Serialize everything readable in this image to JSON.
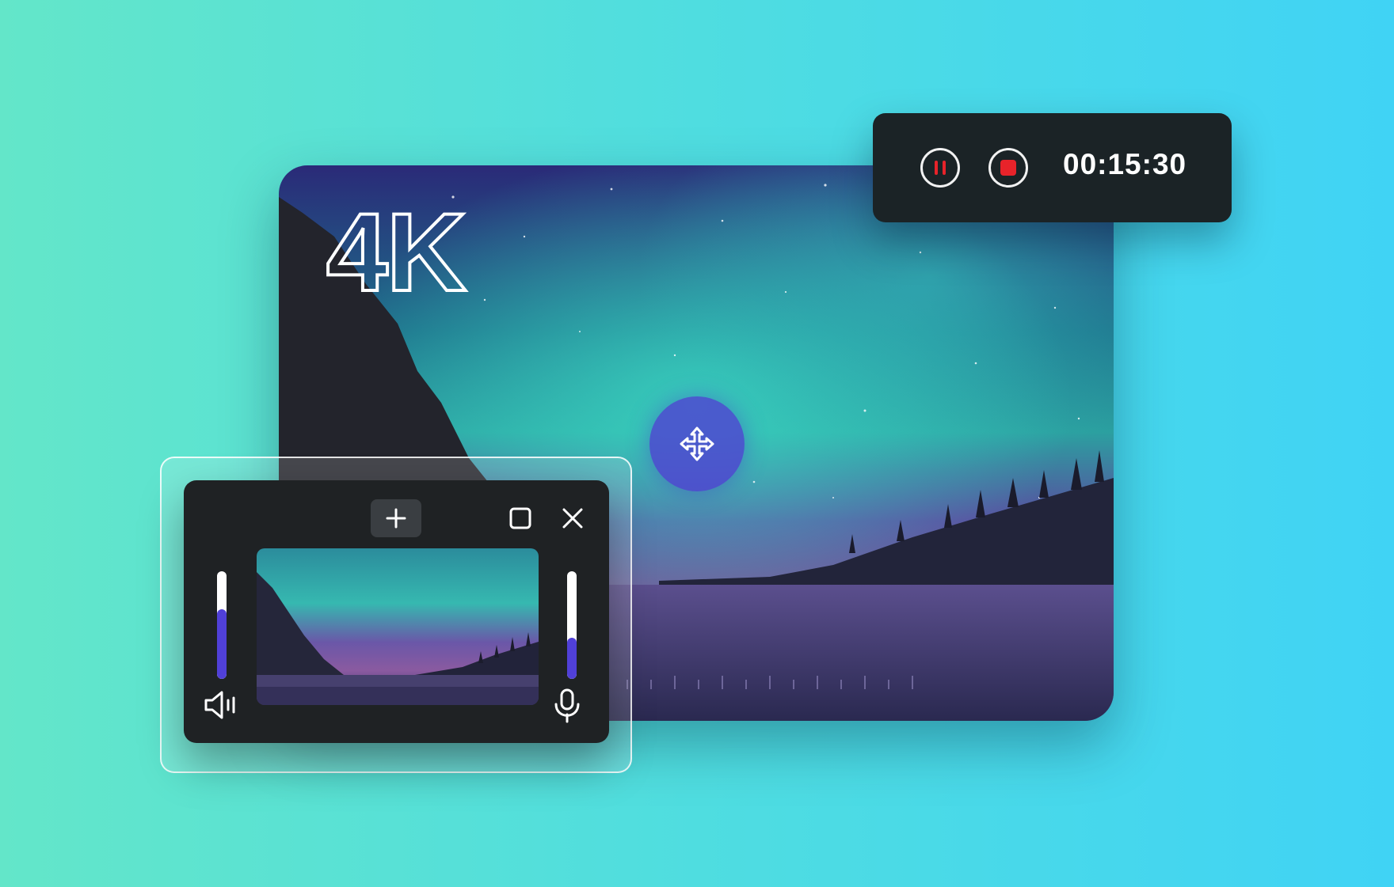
{
  "main_video": {
    "badge": "4K"
  },
  "recording_toolbar": {
    "timer": "00:15:30",
    "pause_icon": "pause-icon",
    "stop_icon": "stop-icon",
    "accent_color": "#e8232a"
  },
  "move_handle": {
    "icon": "move-arrows-icon",
    "color": "#5040d8"
  },
  "mini_panel": {
    "add_icon": "plus-icon",
    "maximize_icon": "square-icon",
    "close_icon": "close-icon",
    "speaker_volume": 0.65,
    "microphone_volume": 0.38,
    "speaker_icon": "speaker-icon",
    "microphone_icon": "microphone-icon"
  }
}
